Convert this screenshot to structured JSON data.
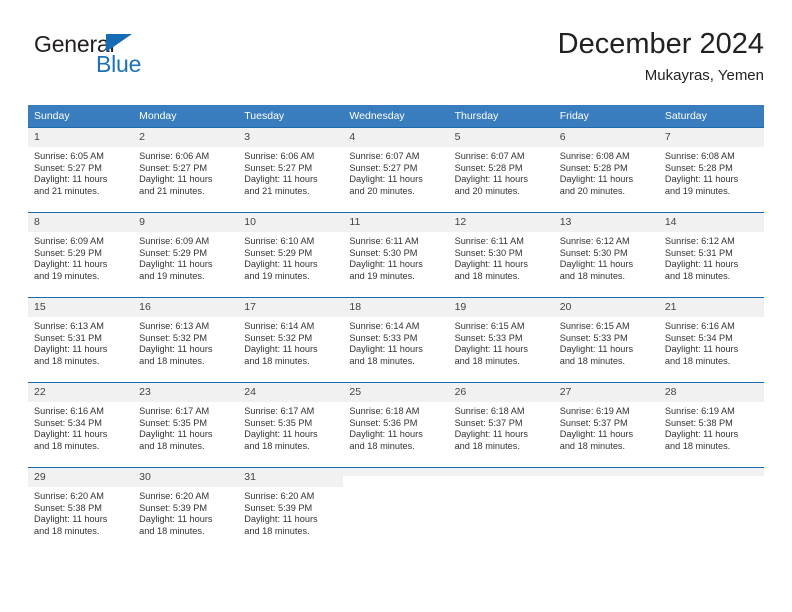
{
  "brand": {
    "name_top": "General",
    "name_bottom": "Blue",
    "triangle_color": "#156cb4",
    "blue_color": "#1b72b8"
  },
  "header": {
    "title": "December 2024",
    "subtitle": "Mukayras, Yemen"
  },
  "theme": {
    "header_row_bg": "#3a7dbf",
    "header_row_text": "#ffffff",
    "daynum_bg": "#f1f1f1",
    "row_border": "#1b6aae"
  },
  "weekday_headers": [
    "Sunday",
    "Monday",
    "Tuesday",
    "Wednesday",
    "Thursday",
    "Friday",
    "Saturday"
  ],
  "weeks": [
    [
      {
        "day": "1",
        "sunrise": "Sunrise: 6:05 AM",
        "sunset": "Sunset: 5:27 PM",
        "daylight_line1": "Daylight: 11 hours",
        "daylight_line2": "and 21 minutes."
      },
      {
        "day": "2",
        "sunrise": "Sunrise: 6:06 AM",
        "sunset": "Sunset: 5:27 PM",
        "daylight_line1": "Daylight: 11 hours",
        "daylight_line2": "and 21 minutes."
      },
      {
        "day": "3",
        "sunrise": "Sunrise: 6:06 AM",
        "sunset": "Sunset: 5:27 PM",
        "daylight_line1": "Daylight: 11 hours",
        "daylight_line2": "and 21 minutes."
      },
      {
        "day": "4",
        "sunrise": "Sunrise: 6:07 AM",
        "sunset": "Sunset: 5:27 PM",
        "daylight_line1": "Daylight: 11 hours",
        "daylight_line2": "and 20 minutes."
      },
      {
        "day": "5",
        "sunrise": "Sunrise: 6:07 AM",
        "sunset": "Sunset: 5:28 PM",
        "daylight_line1": "Daylight: 11 hours",
        "daylight_line2": "and 20 minutes."
      },
      {
        "day": "6",
        "sunrise": "Sunrise: 6:08 AM",
        "sunset": "Sunset: 5:28 PM",
        "daylight_line1": "Daylight: 11 hours",
        "daylight_line2": "and 20 minutes."
      },
      {
        "day": "7",
        "sunrise": "Sunrise: 6:08 AM",
        "sunset": "Sunset: 5:28 PM",
        "daylight_line1": "Daylight: 11 hours",
        "daylight_line2": "and 19 minutes."
      }
    ],
    [
      {
        "day": "8",
        "sunrise": "Sunrise: 6:09 AM",
        "sunset": "Sunset: 5:29 PM",
        "daylight_line1": "Daylight: 11 hours",
        "daylight_line2": "and 19 minutes."
      },
      {
        "day": "9",
        "sunrise": "Sunrise: 6:09 AM",
        "sunset": "Sunset: 5:29 PM",
        "daylight_line1": "Daylight: 11 hours",
        "daylight_line2": "and 19 minutes."
      },
      {
        "day": "10",
        "sunrise": "Sunrise: 6:10 AM",
        "sunset": "Sunset: 5:29 PM",
        "daylight_line1": "Daylight: 11 hours",
        "daylight_line2": "and 19 minutes."
      },
      {
        "day": "11",
        "sunrise": "Sunrise: 6:11 AM",
        "sunset": "Sunset: 5:30 PM",
        "daylight_line1": "Daylight: 11 hours",
        "daylight_line2": "and 19 minutes."
      },
      {
        "day": "12",
        "sunrise": "Sunrise: 6:11 AM",
        "sunset": "Sunset: 5:30 PM",
        "daylight_line1": "Daylight: 11 hours",
        "daylight_line2": "and 18 minutes."
      },
      {
        "day": "13",
        "sunrise": "Sunrise: 6:12 AM",
        "sunset": "Sunset: 5:30 PM",
        "daylight_line1": "Daylight: 11 hours",
        "daylight_line2": "and 18 minutes."
      },
      {
        "day": "14",
        "sunrise": "Sunrise: 6:12 AM",
        "sunset": "Sunset: 5:31 PM",
        "daylight_line1": "Daylight: 11 hours",
        "daylight_line2": "and 18 minutes."
      }
    ],
    [
      {
        "day": "15",
        "sunrise": "Sunrise: 6:13 AM",
        "sunset": "Sunset: 5:31 PM",
        "daylight_line1": "Daylight: 11 hours",
        "daylight_line2": "and 18 minutes."
      },
      {
        "day": "16",
        "sunrise": "Sunrise: 6:13 AM",
        "sunset": "Sunset: 5:32 PM",
        "daylight_line1": "Daylight: 11 hours",
        "daylight_line2": "and 18 minutes."
      },
      {
        "day": "17",
        "sunrise": "Sunrise: 6:14 AM",
        "sunset": "Sunset: 5:32 PM",
        "daylight_line1": "Daylight: 11 hours",
        "daylight_line2": "and 18 minutes."
      },
      {
        "day": "18",
        "sunrise": "Sunrise: 6:14 AM",
        "sunset": "Sunset: 5:33 PM",
        "daylight_line1": "Daylight: 11 hours",
        "daylight_line2": "and 18 minutes."
      },
      {
        "day": "19",
        "sunrise": "Sunrise: 6:15 AM",
        "sunset": "Sunset: 5:33 PM",
        "daylight_line1": "Daylight: 11 hours",
        "daylight_line2": "and 18 minutes."
      },
      {
        "day": "20",
        "sunrise": "Sunrise: 6:15 AM",
        "sunset": "Sunset: 5:33 PM",
        "daylight_line1": "Daylight: 11 hours",
        "daylight_line2": "and 18 minutes."
      },
      {
        "day": "21",
        "sunrise": "Sunrise: 6:16 AM",
        "sunset": "Sunset: 5:34 PM",
        "daylight_line1": "Daylight: 11 hours",
        "daylight_line2": "and 18 minutes."
      }
    ],
    [
      {
        "day": "22",
        "sunrise": "Sunrise: 6:16 AM",
        "sunset": "Sunset: 5:34 PM",
        "daylight_line1": "Daylight: 11 hours",
        "daylight_line2": "and 18 minutes."
      },
      {
        "day": "23",
        "sunrise": "Sunrise: 6:17 AM",
        "sunset": "Sunset: 5:35 PM",
        "daylight_line1": "Daylight: 11 hours",
        "daylight_line2": "and 18 minutes."
      },
      {
        "day": "24",
        "sunrise": "Sunrise: 6:17 AM",
        "sunset": "Sunset: 5:35 PM",
        "daylight_line1": "Daylight: 11 hours",
        "daylight_line2": "and 18 minutes."
      },
      {
        "day": "25",
        "sunrise": "Sunrise: 6:18 AM",
        "sunset": "Sunset: 5:36 PM",
        "daylight_line1": "Daylight: 11 hours",
        "daylight_line2": "and 18 minutes."
      },
      {
        "day": "26",
        "sunrise": "Sunrise: 6:18 AM",
        "sunset": "Sunset: 5:37 PM",
        "daylight_line1": "Daylight: 11 hours",
        "daylight_line2": "and 18 minutes."
      },
      {
        "day": "27",
        "sunrise": "Sunrise: 6:19 AM",
        "sunset": "Sunset: 5:37 PM",
        "daylight_line1": "Daylight: 11 hours",
        "daylight_line2": "and 18 minutes."
      },
      {
        "day": "28",
        "sunrise": "Sunrise: 6:19 AM",
        "sunset": "Sunset: 5:38 PM",
        "daylight_line1": "Daylight: 11 hours",
        "daylight_line2": "and 18 minutes."
      }
    ],
    [
      {
        "day": "29",
        "sunrise": "Sunrise: 6:20 AM",
        "sunset": "Sunset: 5:38 PM",
        "daylight_line1": "Daylight: 11 hours",
        "daylight_line2": "and 18 minutes."
      },
      {
        "day": "30",
        "sunrise": "Sunrise: 6:20 AM",
        "sunset": "Sunset: 5:39 PM",
        "daylight_line1": "Daylight: 11 hours",
        "daylight_line2": "and 18 minutes."
      },
      {
        "day": "31",
        "sunrise": "Sunrise: 6:20 AM",
        "sunset": "Sunset: 5:39 PM",
        "daylight_line1": "Daylight: 11 hours",
        "daylight_line2": "and 18 minutes."
      },
      {
        "day": "",
        "sunrise": "",
        "sunset": "",
        "daylight_line1": "",
        "daylight_line2": ""
      },
      {
        "day": "",
        "sunrise": "",
        "sunset": "",
        "daylight_line1": "",
        "daylight_line2": ""
      },
      {
        "day": "",
        "sunrise": "",
        "sunset": "",
        "daylight_line1": "",
        "daylight_line2": ""
      },
      {
        "day": "",
        "sunrise": "",
        "sunset": "",
        "daylight_line1": "",
        "daylight_line2": ""
      }
    ]
  ]
}
